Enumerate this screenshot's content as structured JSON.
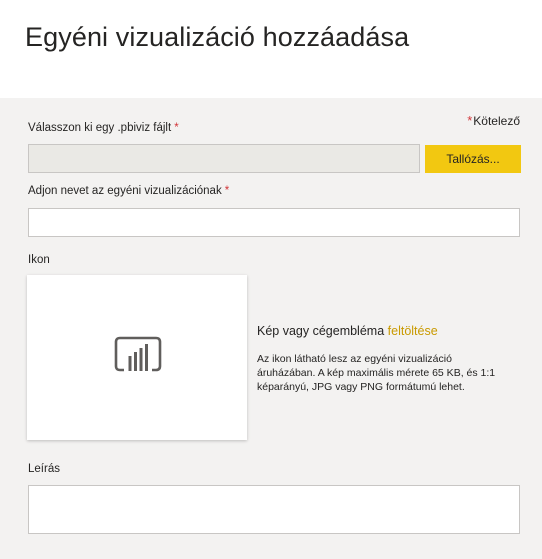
{
  "dialog": {
    "title": "Egyéni vizualizáció hozzáadása"
  },
  "required_note": {
    "star": "*",
    "text": "Kötelező"
  },
  "file_field": {
    "label": "Válasszon ki egy .pbiviz fájlt",
    "required_star": "*",
    "value": "",
    "browse_label": "Tallózás..."
  },
  "name_field": {
    "label": "Adjon nevet az egyéni vizualizációnak",
    "required_star": "*",
    "value": ""
  },
  "icon_section": {
    "label": "Ikon",
    "tile_icon": "report-chart-icon",
    "upload_text": "Kép vagy cégembléma",
    "upload_link": "feltöltése",
    "help_lines": [
      "Az ikon látható lesz az egyéni vizualizáció",
      "áruházában. A kép maximális mérete 65 KB, és 1:1",
      "képarányú, JPG vagy PNG formátumú lehet."
    ]
  },
  "description_field": {
    "label": "Leírás",
    "value": ""
  },
  "colors": {
    "accent": "#f2c811",
    "link": "#c99a00",
    "required": "#d13438",
    "panel_bg": "#f3f2f1"
  }
}
